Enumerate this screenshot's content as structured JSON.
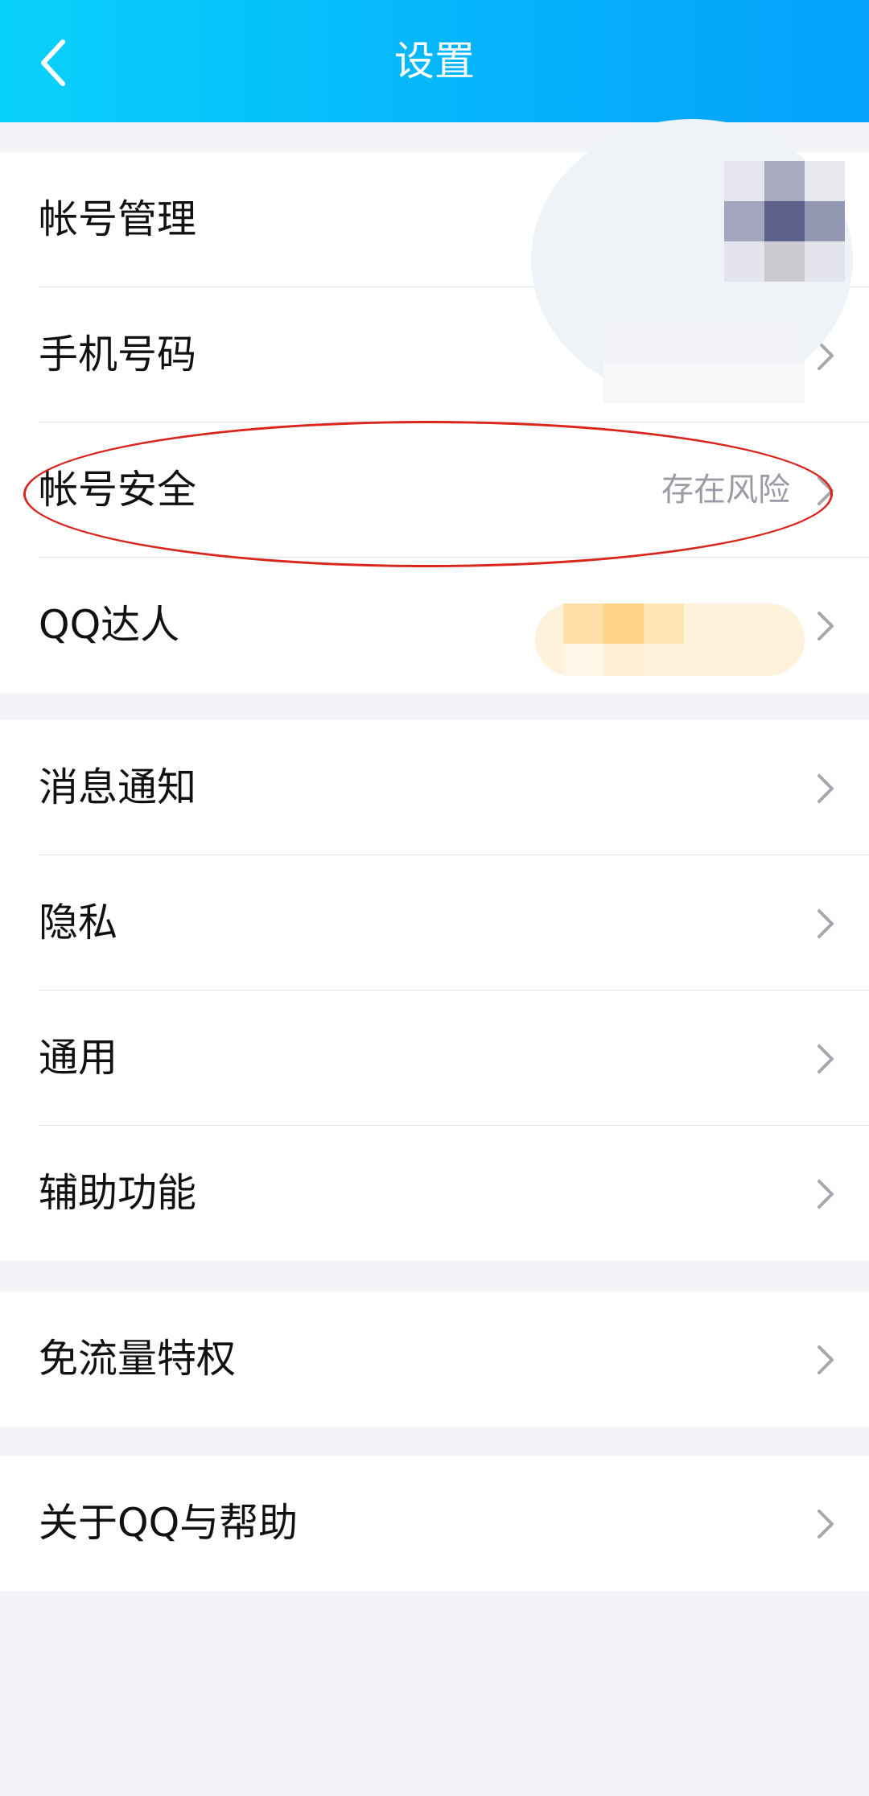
{
  "header": {
    "title": "设置"
  },
  "groups": [
    {
      "items": [
        {
          "label": "帐号管理"
        },
        {
          "label": "手机号码"
        },
        {
          "label": "帐号安全",
          "value": "存在风险"
        },
        {
          "label": "QQ达人"
        }
      ]
    },
    {
      "items": [
        {
          "label": "消息通知"
        },
        {
          "label": "隐私"
        },
        {
          "label": "通用"
        },
        {
          "label": "辅助功能"
        }
      ]
    },
    {
      "items": [
        {
          "label": "免流量特权"
        }
      ]
    },
    {
      "items": [
        {
          "label": "关于QQ与帮助"
        }
      ]
    }
  ],
  "colors": {
    "header_gradient_start": "#08d2fb",
    "header_gradient_end": "#05a1fb",
    "highlight_ring": "#d9261c",
    "page_background": "#f3f4f8"
  }
}
